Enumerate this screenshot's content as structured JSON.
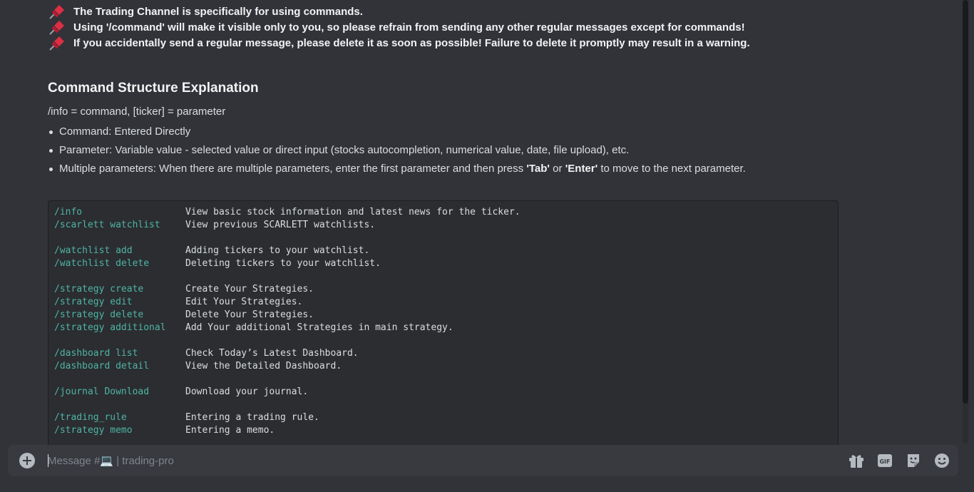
{
  "rules": [
    {
      "icon": "pushpin-icon",
      "text": "The Trading Channel is specifically for using commands."
    },
    {
      "icon": "pushpin-icon",
      "text": "Using '/command' will make it visible only to you, so please refrain from sending any other regular messages except for commands!"
    },
    {
      "icon": "pushpin-icon",
      "text": "If you accidentally send a regular message, please delete it as soon as possible! Failure to delete it promptly may result in a warning."
    }
  ],
  "heading": "Command Structure Explanation",
  "definition": "/info = command, [ticker] = parameter",
  "bullets": {
    "b1": "Command: Entered Directly",
    "b2": "Parameter: Variable value - selected value or direct input (stocks autocompletion, numerical value, date, file upload), etc.",
    "b3_pre": "Multiple parameters: When there are multiple parameters, enter the first parameter and then press ",
    "b3_tab": "'Tab'",
    "b3_or": " or ",
    "b3_enter": "'Enter'",
    "b3_post": " to move to the next parameter."
  },
  "commands": [
    {
      "cmd": "/info",
      "desc": "View basic stock information and latest news for the ticker."
    },
    {
      "cmd": "/scarlett watchlist",
      "desc": "View previous SCARLETT watchlists."
    },
    {
      "cmd": "/watchlist add",
      "desc": "Adding tickers to your watchlist."
    },
    {
      "cmd": "/watchlist delete",
      "desc": "Deleting tickers to your watchlist."
    },
    {
      "cmd": "/strategy create",
      "desc": "Create Your Strategies."
    },
    {
      "cmd": "/strategy edit",
      "desc": "Edit Your Strategies."
    },
    {
      "cmd": "/strategy delete",
      "desc": "Delete Your Strategies."
    },
    {
      "cmd": "/strategy additional",
      "desc": "Add Your additional Strategies in main strategy."
    },
    {
      "cmd": "/dashboard list",
      "desc": "Check Today’s Latest Dashboard."
    },
    {
      "cmd": "/dashboard detail",
      "desc": "View the Detailed Dashboard."
    },
    {
      "cmd": "/journal Download",
      "desc": "Download your journal."
    },
    {
      "cmd": "/trading_rule",
      "desc": "Entering a trading rule."
    },
    {
      "cmd": "/strategy memo",
      "desc": "Entering a memo."
    }
  ],
  "composer": {
    "placeholder": "Message #💻 | trading-pro",
    "tools": [
      "gift-icon",
      "gif-icon",
      "sticker-icon",
      "emoji-icon"
    ]
  },
  "colors": {
    "background": "#313338",
    "code_bg": "#2b2d31",
    "command": "#4fb4a4",
    "pin": "#dd2e44"
  }
}
